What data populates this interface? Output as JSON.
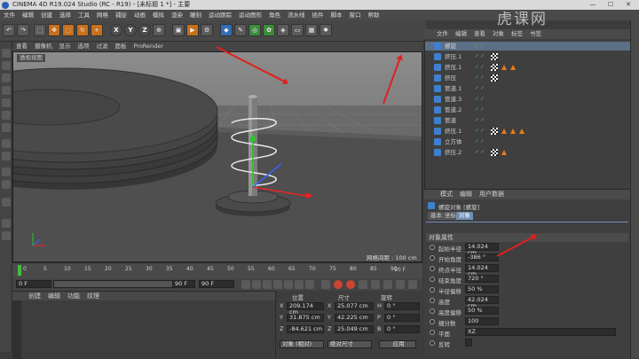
{
  "window": {
    "title": "CINEMA 4D R19.024 Studio (RC - R19) - [未标题 1 *] - 主要",
    "controls": [
      "—",
      "☐",
      "✕"
    ]
  },
  "menubar": [
    "文件",
    "编辑",
    "创建",
    "选择",
    "工具",
    "网格",
    "捕捉",
    "动画",
    "模拟",
    "渲染",
    "雕刻",
    "运动跟踪",
    "运动图形",
    "角色",
    "流水线",
    "插件",
    "脚本",
    "窗口",
    "帮助"
  ],
  "watermark": "虎课网",
  "toolbar": {
    "axis_x": "X",
    "axis_y": "Y",
    "axis_z": "Z"
  },
  "viewport": {
    "menu": [
      "查看",
      "摄像机",
      "显示",
      "选项",
      "过滤",
      "面板",
      "ProRender"
    ],
    "label": "透视视图",
    "grid_text": "网格间距 : 100 cm"
  },
  "timeline": {
    "ticks": [
      "0",
      "5",
      "10",
      "15",
      "20",
      "25",
      "30",
      "35",
      "40",
      "45",
      "50",
      "55",
      "60",
      "65",
      "70",
      "75",
      "80",
      "85",
      "90"
    ],
    "end": "90 F"
  },
  "playbar": {
    "start": "0 F",
    "current": "0 F",
    "end": "90 F",
    "end2": "90 F"
  },
  "material_manager": {
    "tabs": [
      "创建",
      "编辑",
      "功能",
      "纹理"
    ]
  },
  "coordinates": {
    "headers": [
      "位置",
      "尺寸",
      "旋转"
    ],
    "rows": [
      {
        "axis": "X",
        "pos": "209.174 cm",
        "size_axis": "X",
        "size": "25.077 cm",
        "rot_axis": "H",
        "rot": "0 °"
      },
      {
        "axis": "Y",
        "pos": "31.875 cm",
        "size_axis": "Y",
        "size": "42.225 cm",
        "rot_axis": "P",
        "rot": "0 °"
      },
      {
        "axis": "Z",
        "pos": "-84.621 cm",
        "size_axis": "Z",
        "size": "25.049 cm",
        "rot_axis": "B",
        "rot": "0 °"
      }
    ],
    "mode": "对象 (相对)",
    "size_mode": "绝对尺寸",
    "apply": "应用"
  },
  "object_manager": {
    "menu": [
      "文件",
      "编辑",
      "查看",
      "对象",
      "标签",
      "书签"
    ],
    "items": [
      {
        "name": "螺旋",
        "color": "#3f7fd0",
        "indent": 0,
        "selected": true,
        "tags": 0
      },
      {
        "name": "挤压.1",
        "color": "#3f7fd0",
        "indent": 0,
        "tags": 1
      },
      {
        "name": "挤压.1",
        "color": "#3f7fd0",
        "indent": 0,
        "tags": 3
      },
      {
        "name": "挤压",
        "color": "#3f7fd0",
        "indent": 0,
        "tags": 1
      },
      {
        "name": "管道.1",
        "color": "#3f7fd0",
        "indent": 0,
        "tags": 0
      },
      {
        "name": "管道.3",
        "color": "#3f7fd0",
        "indent": 0,
        "tags": 0
      },
      {
        "name": "管道.2",
        "color": "#3f7fd0",
        "indent": 0,
        "tags": 0
      },
      {
        "name": "管道",
        "color": "#3f7fd0",
        "indent": 0,
        "tags": 0
      },
      {
        "name": "挤压.1",
        "color": "#3f7fd0",
        "indent": 0,
        "tags": 4
      },
      {
        "name": "立方体",
        "color": "#3f7fd0",
        "indent": 0,
        "tags": 0
      },
      {
        "name": "挤压.2",
        "color": "#3f7fd0",
        "indent": 0,
        "tags": 2
      }
    ]
  },
  "attribute_manager": {
    "menu": [
      "模式",
      "编辑",
      "用户数据"
    ],
    "object_title": "螺旋对象 [螺旋]",
    "tabs": [
      "基本",
      "坐标",
      "对象"
    ],
    "section": "对象属性",
    "fields": [
      {
        "label": "起始半径",
        "value": "14.024 cm"
      },
      {
        "label": "开始角度",
        "value": "-386 °"
      },
      {
        "label": "终点半径",
        "value": "14.024 cm"
      },
      {
        "label": "结束角度",
        "value": "720 °"
      },
      {
        "label": "半径偏移",
        "value": "50 %"
      },
      {
        "label": "高度",
        "value": "42.024 cm"
      },
      {
        "label": "高度偏移",
        "value": "50 %"
      },
      {
        "label": "细分数",
        "value": "100"
      },
      {
        "label": "平面",
        "value": "XZ"
      },
      {
        "label": "反转",
        "value": ""
      }
    ]
  },
  "colors": {
    "accent": "#6e8fb5",
    "annotation": "#e02020",
    "tag_orange": "#e87a1a"
  }
}
